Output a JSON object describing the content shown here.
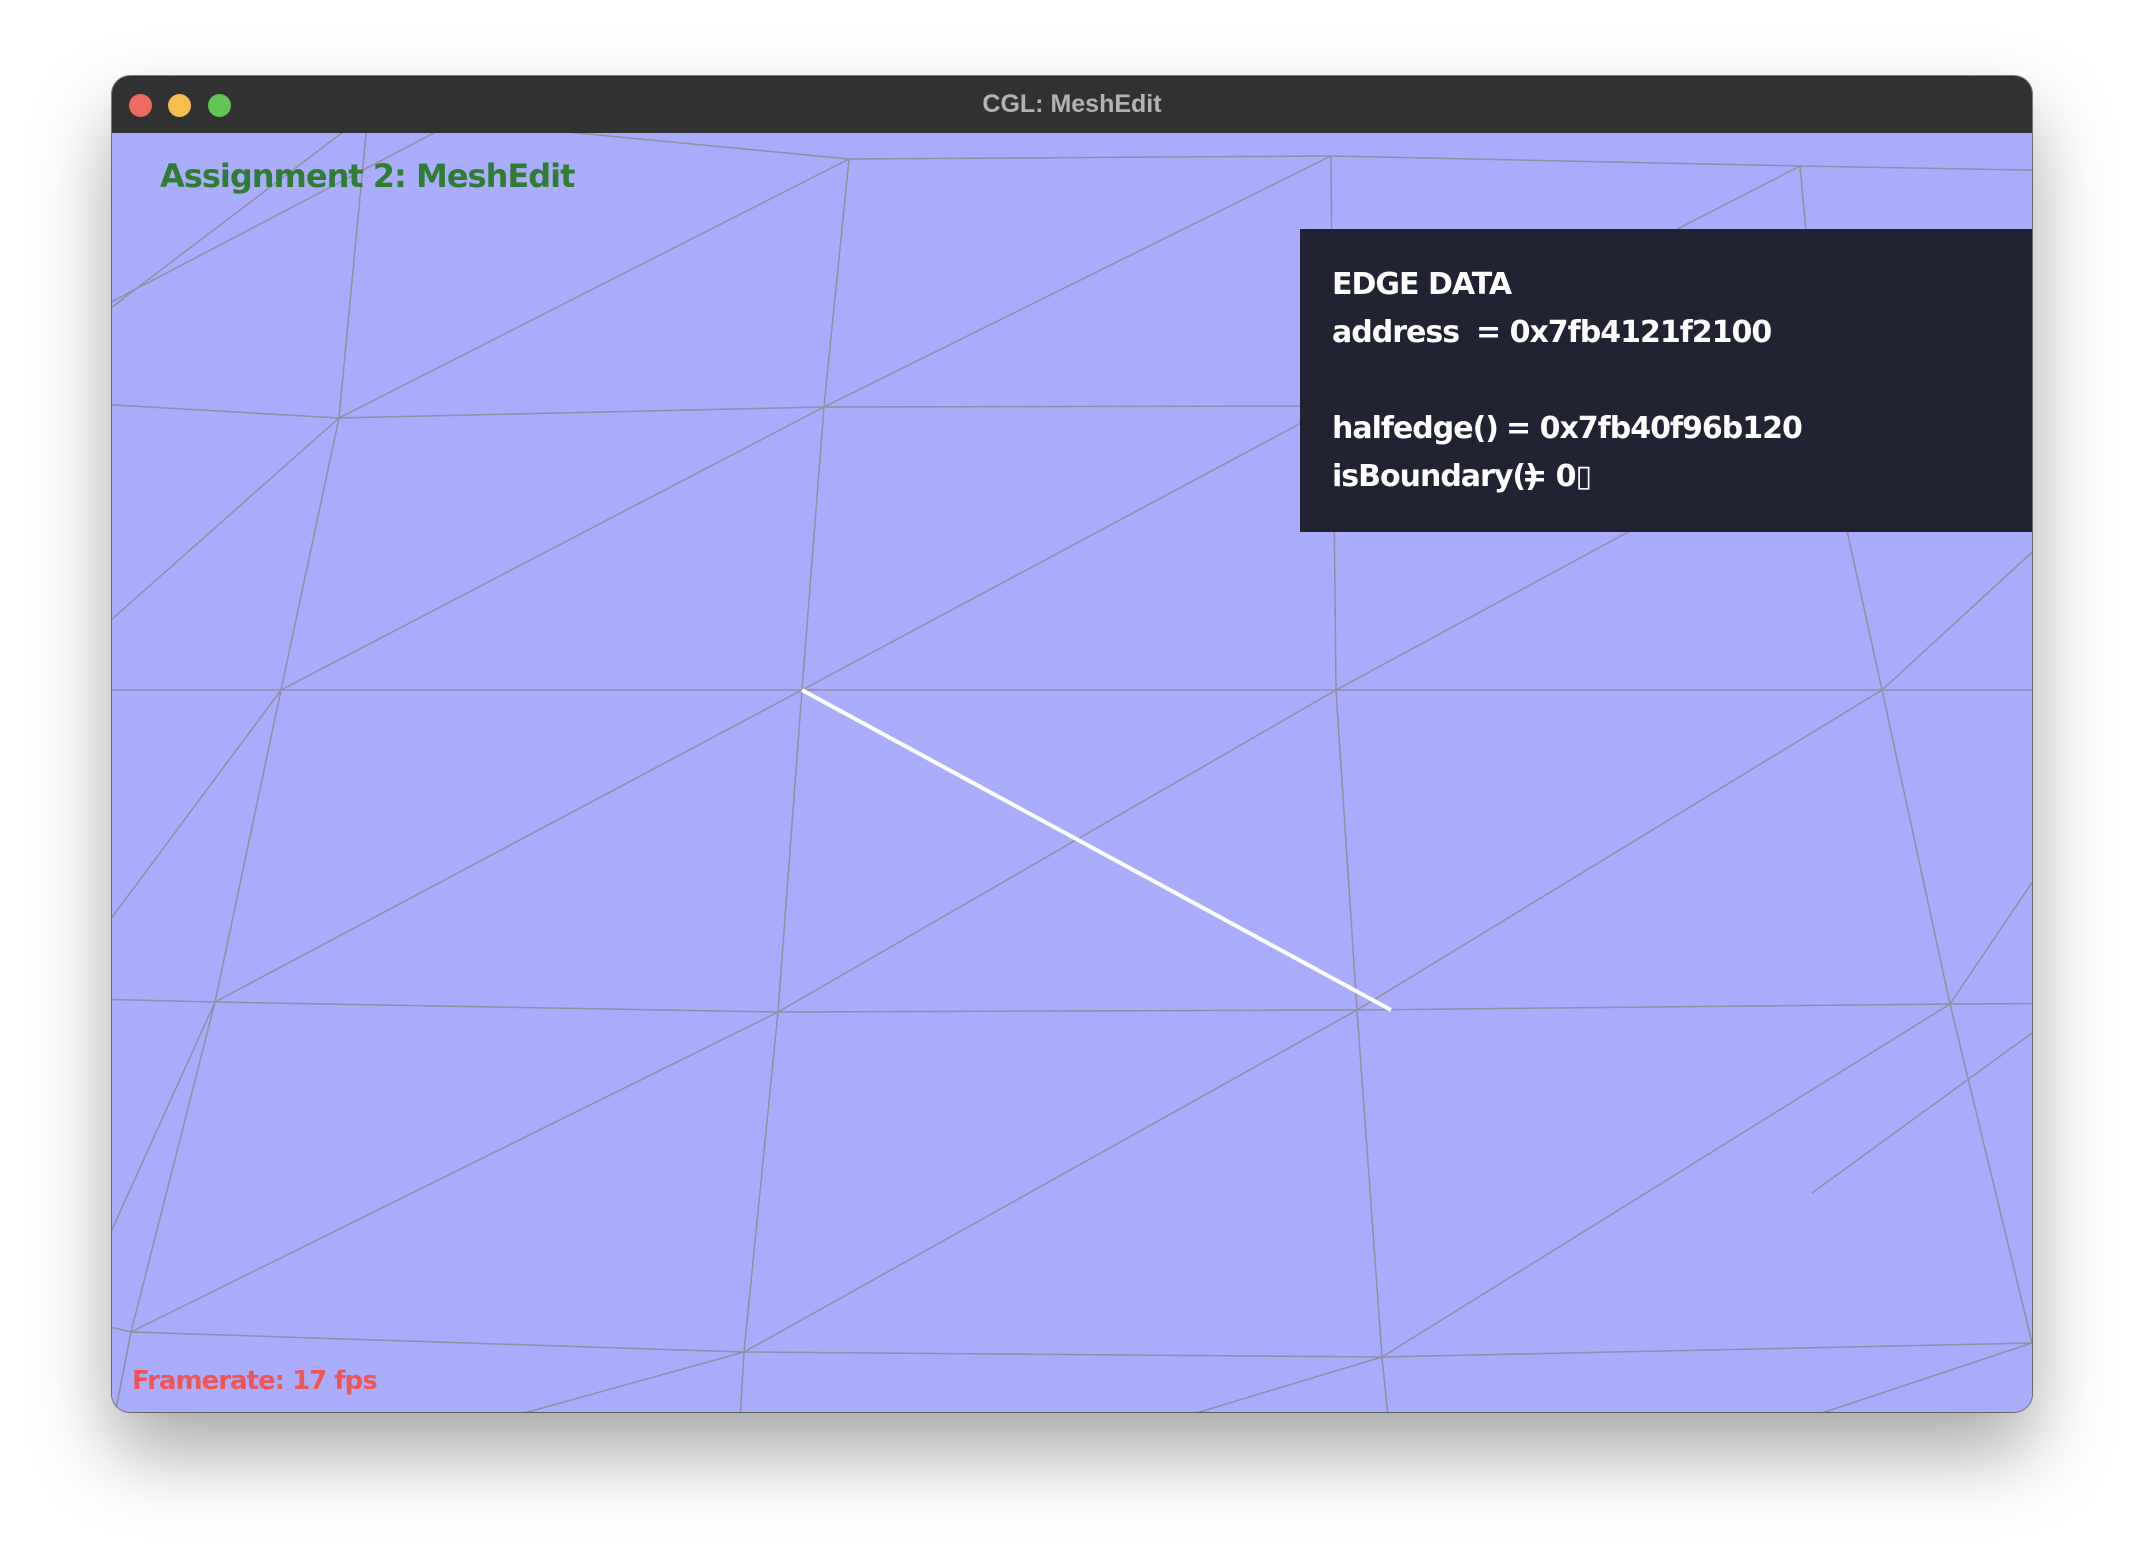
{
  "window": {
    "title": "CGL: MeshEdit"
  },
  "viewport": {
    "assignment_title": "Assignment 2: MeshEdit",
    "framerate": "Framerate: 17 fps",
    "colors": {
      "background": "#aaadfd",
      "wireframe": "#8f8f9e",
      "selected_edge": "#ffffff",
      "title_text": "#2e7d32",
      "framerate_text": "#f05555"
    }
  },
  "edge_data": {
    "heading": "EDGE DATA",
    "address_label": "address",
    "address_value": "= 0x7fb4121f2100",
    "halfedge_label": "halfedge()",
    "halfedge_value": "= 0x7fb40f96b120",
    "boundary_label": "isBoundary()",
    "boundary_value": "= 0▯"
  }
}
